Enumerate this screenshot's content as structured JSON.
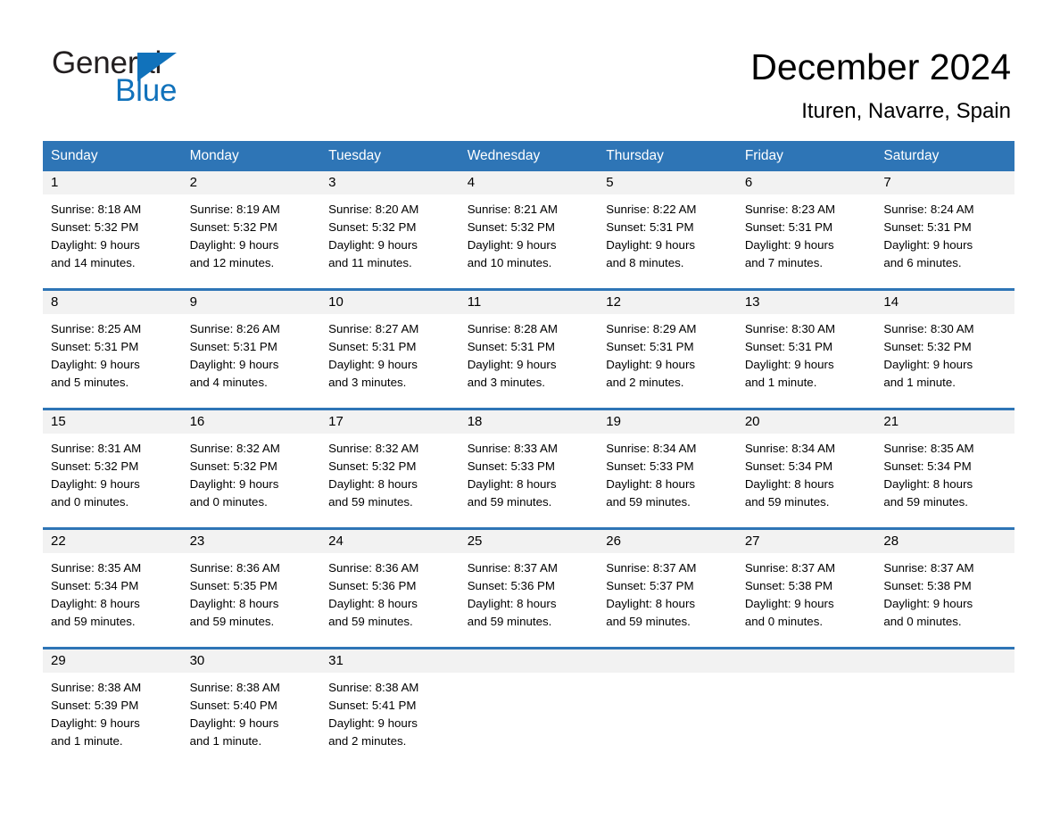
{
  "brand": {
    "name_part1": "General",
    "name_part2": "Blue",
    "triangle_icon": "brand-triangle-icon",
    "accent_color": "#1172bb",
    "text_color": "#231f20"
  },
  "header": {
    "title": "December 2024",
    "subtitle": "Ituren, Navarre, Spain"
  },
  "theme": {
    "header_blue": "#2e75b6",
    "daynum_band_gray": "#f2f2f2",
    "page_background": "#ffffff",
    "text_black": "#000000"
  },
  "calendar": {
    "weekday_headers": [
      "Sunday",
      "Monday",
      "Tuesday",
      "Wednesday",
      "Thursday",
      "Friday",
      "Saturday"
    ],
    "weeks": [
      [
        {
          "day": "1",
          "lines": [
            "Sunrise: 8:18 AM",
            "Sunset: 5:32 PM",
            "Daylight: 9 hours",
            "and 14 minutes."
          ]
        },
        {
          "day": "2",
          "lines": [
            "Sunrise: 8:19 AM",
            "Sunset: 5:32 PM",
            "Daylight: 9 hours",
            "and 12 minutes."
          ]
        },
        {
          "day": "3",
          "lines": [
            "Sunrise: 8:20 AM",
            "Sunset: 5:32 PM",
            "Daylight: 9 hours",
            "and 11 minutes."
          ]
        },
        {
          "day": "4",
          "lines": [
            "Sunrise: 8:21 AM",
            "Sunset: 5:32 PM",
            "Daylight: 9 hours",
            "and 10 minutes."
          ]
        },
        {
          "day": "5",
          "lines": [
            "Sunrise: 8:22 AM",
            "Sunset: 5:31 PM",
            "Daylight: 9 hours",
            "and 8 minutes."
          ]
        },
        {
          "day": "6",
          "lines": [
            "Sunrise: 8:23 AM",
            "Sunset: 5:31 PM",
            "Daylight: 9 hours",
            "and 7 minutes."
          ]
        },
        {
          "day": "7",
          "lines": [
            "Sunrise: 8:24 AM",
            "Sunset: 5:31 PM",
            "Daylight: 9 hours",
            "and 6 minutes."
          ]
        }
      ],
      [
        {
          "day": "8",
          "lines": [
            "Sunrise: 8:25 AM",
            "Sunset: 5:31 PM",
            "Daylight: 9 hours",
            "and 5 minutes."
          ]
        },
        {
          "day": "9",
          "lines": [
            "Sunrise: 8:26 AM",
            "Sunset: 5:31 PM",
            "Daylight: 9 hours",
            "and 4 minutes."
          ]
        },
        {
          "day": "10",
          "lines": [
            "Sunrise: 8:27 AM",
            "Sunset: 5:31 PM",
            "Daylight: 9 hours",
            "and 3 minutes."
          ]
        },
        {
          "day": "11",
          "lines": [
            "Sunrise: 8:28 AM",
            "Sunset: 5:31 PM",
            "Daylight: 9 hours",
            "and 3 minutes."
          ]
        },
        {
          "day": "12",
          "lines": [
            "Sunrise: 8:29 AM",
            "Sunset: 5:31 PM",
            "Daylight: 9 hours",
            "and 2 minutes."
          ]
        },
        {
          "day": "13",
          "lines": [
            "Sunrise: 8:30 AM",
            "Sunset: 5:31 PM",
            "Daylight: 9 hours",
            "and 1 minute."
          ]
        },
        {
          "day": "14",
          "lines": [
            "Sunrise: 8:30 AM",
            "Sunset: 5:32 PM",
            "Daylight: 9 hours",
            "and 1 minute."
          ]
        }
      ],
      [
        {
          "day": "15",
          "lines": [
            "Sunrise: 8:31 AM",
            "Sunset: 5:32 PM",
            "Daylight: 9 hours",
            "and 0 minutes."
          ]
        },
        {
          "day": "16",
          "lines": [
            "Sunrise: 8:32 AM",
            "Sunset: 5:32 PM",
            "Daylight: 9 hours",
            "and 0 minutes."
          ]
        },
        {
          "day": "17",
          "lines": [
            "Sunrise: 8:32 AM",
            "Sunset: 5:32 PM",
            "Daylight: 8 hours",
            "and 59 minutes."
          ]
        },
        {
          "day": "18",
          "lines": [
            "Sunrise: 8:33 AM",
            "Sunset: 5:33 PM",
            "Daylight: 8 hours",
            "and 59 minutes."
          ]
        },
        {
          "day": "19",
          "lines": [
            "Sunrise: 8:34 AM",
            "Sunset: 5:33 PM",
            "Daylight: 8 hours",
            "and 59 minutes."
          ]
        },
        {
          "day": "20",
          "lines": [
            "Sunrise: 8:34 AM",
            "Sunset: 5:34 PM",
            "Daylight: 8 hours",
            "and 59 minutes."
          ]
        },
        {
          "day": "21",
          "lines": [
            "Sunrise: 8:35 AM",
            "Sunset: 5:34 PM",
            "Daylight: 8 hours",
            "and 59 minutes."
          ]
        }
      ],
      [
        {
          "day": "22",
          "lines": [
            "Sunrise: 8:35 AM",
            "Sunset: 5:34 PM",
            "Daylight: 8 hours",
            "and 59 minutes."
          ]
        },
        {
          "day": "23",
          "lines": [
            "Sunrise: 8:36 AM",
            "Sunset: 5:35 PM",
            "Daylight: 8 hours",
            "and 59 minutes."
          ]
        },
        {
          "day": "24",
          "lines": [
            "Sunrise: 8:36 AM",
            "Sunset: 5:36 PM",
            "Daylight: 8 hours",
            "and 59 minutes."
          ]
        },
        {
          "day": "25",
          "lines": [
            "Sunrise: 8:37 AM",
            "Sunset: 5:36 PM",
            "Daylight: 8 hours",
            "and 59 minutes."
          ]
        },
        {
          "day": "26",
          "lines": [
            "Sunrise: 8:37 AM",
            "Sunset: 5:37 PM",
            "Daylight: 8 hours",
            "and 59 minutes."
          ]
        },
        {
          "day": "27",
          "lines": [
            "Sunrise: 8:37 AM",
            "Sunset: 5:38 PM",
            "Daylight: 9 hours",
            "and 0 minutes."
          ]
        },
        {
          "day": "28",
          "lines": [
            "Sunrise: 8:37 AM",
            "Sunset: 5:38 PM",
            "Daylight: 9 hours",
            "and 0 minutes."
          ]
        }
      ],
      [
        {
          "day": "29",
          "lines": [
            "Sunrise: 8:38 AM",
            "Sunset: 5:39 PM",
            "Daylight: 9 hours",
            "and 1 minute."
          ]
        },
        {
          "day": "30",
          "lines": [
            "Sunrise: 8:38 AM",
            "Sunset: 5:40 PM",
            "Daylight: 9 hours",
            "and 1 minute."
          ]
        },
        {
          "day": "31",
          "lines": [
            "Sunrise: 8:38 AM",
            "Sunset: 5:41 PM",
            "Daylight: 9 hours",
            "and 2 minutes."
          ]
        },
        {
          "day": "",
          "lines": []
        },
        {
          "day": "",
          "lines": []
        },
        {
          "day": "",
          "lines": []
        },
        {
          "day": "",
          "lines": []
        }
      ]
    ]
  }
}
